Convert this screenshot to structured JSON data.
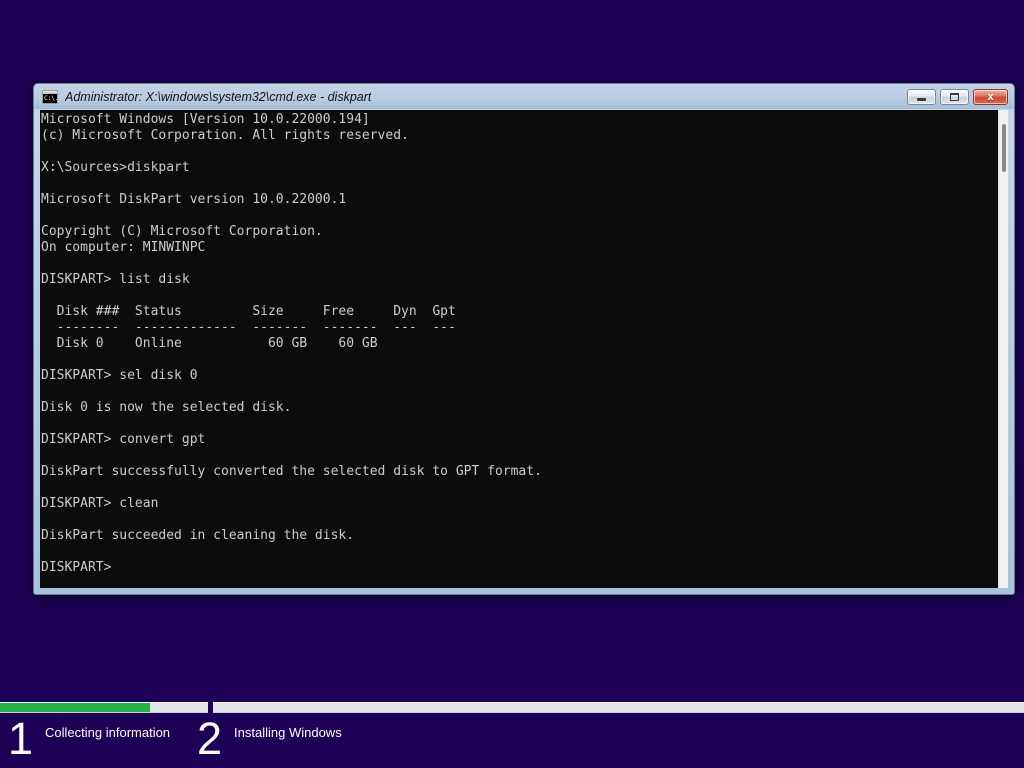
{
  "background_color": "#1c0156",
  "window": {
    "title": "Administrator: X:\\windows\\system32\\cmd.exe - diskpart",
    "icon_text": "C:\\.",
    "controls": {
      "minimize": "minimize",
      "maximize": "maximize",
      "close": "close",
      "close_glyph": "x"
    }
  },
  "console": {
    "lines": [
      "Microsoft Windows [Version 10.0.22000.194]",
      "(c) Microsoft Corporation. All rights reserved.",
      "",
      "X:\\Sources>diskpart",
      "",
      "Microsoft DiskPart version 10.0.22000.1",
      "",
      "Copyright (C) Microsoft Corporation.",
      "On computer: MINWINPC",
      "",
      "DISKPART> list disk",
      "",
      "  Disk ###  Status         Size     Free     Dyn  Gpt",
      "  --------  -------------  -------  -------  ---  ---",
      "  Disk 0    Online           60 GB    60 GB",
      "",
      "DISKPART> sel disk 0",
      "",
      "Disk 0 is now the selected disk.",
      "",
      "DISKPART> convert gpt",
      "",
      "DiskPart successfully converted the selected disk to GPT format.",
      "",
      "DISKPART> clean",
      "",
      "DiskPart succeeded in cleaning the disk.",
      "",
      "DISKPART>"
    ]
  },
  "setup_progress": {
    "progress_color": "#26b14c",
    "steps": [
      {
        "number": "1",
        "label": "Collecting information",
        "progress_percent": 72
      },
      {
        "number": "2",
        "label": "Installing Windows",
        "progress_percent": 0
      }
    ]
  }
}
